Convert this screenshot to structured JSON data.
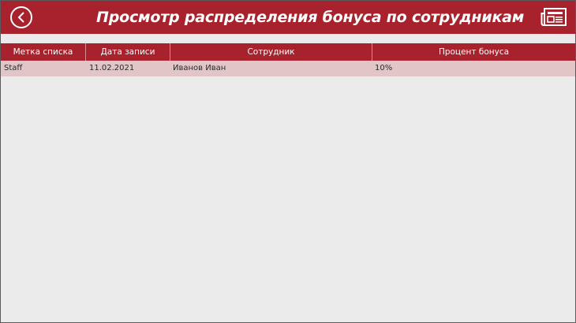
{
  "header": {
    "title": "Просмотр распределения бонуса по сотрудникам",
    "back_icon": "back-arrow-icon",
    "right_icon": "newspaper-icon",
    "brand_color": "#a8222d"
  },
  "table": {
    "columns": [
      "Метка списка",
      "Дата записи",
      "Сотрудник",
      "Процент бонуса"
    ],
    "rows": [
      [
        "Staff",
        "11.02.2021",
        "Иванов Иван",
        "10%"
      ]
    ]
  }
}
